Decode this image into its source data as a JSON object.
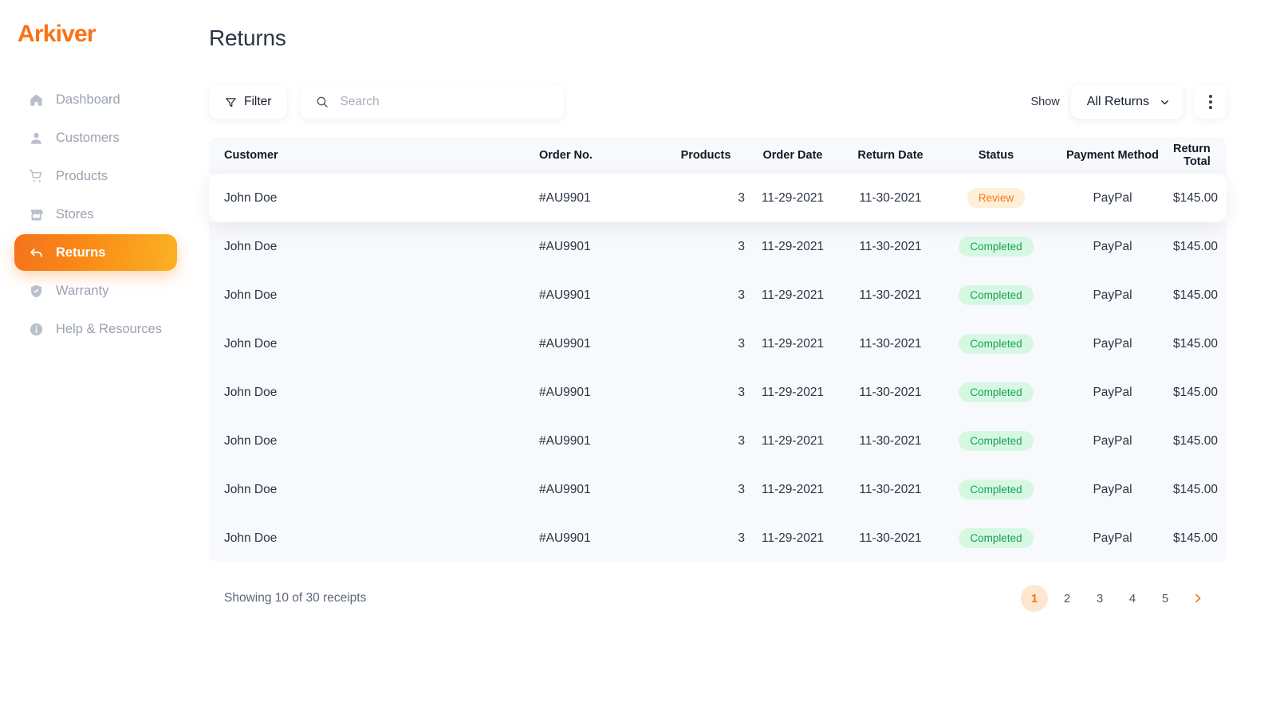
{
  "brand": {
    "name": "Arkiver",
    "color": "#F97316"
  },
  "sidebar": {
    "items": [
      {
        "label": "Dashboard",
        "icon": "home-icon",
        "active": false
      },
      {
        "label": "Customers",
        "icon": "user-icon",
        "active": false
      },
      {
        "label": "Products",
        "icon": "cart-icon",
        "active": false
      },
      {
        "label": "Stores",
        "icon": "store-icon",
        "active": false
      },
      {
        "label": "Returns",
        "icon": "return-icon",
        "active": true
      },
      {
        "label": "Warranty",
        "icon": "shield-icon",
        "active": false
      },
      {
        "label": "Help & Resources",
        "icon": "info-icon",
        "active": false
      }
    ]
  },
  "header": {
    "title": "Returns"
  },
  "toolbar": {
    "filter_label": "Filter",
    "filter_icon": "funnel-icon",
    "search_placeholder": "Search",
    "search_value": "",
    "search_icon": "search-icon",
    "show_label": "Show",
    "select_value": "All Returns",
    "select_icon": "chevron-down-icon",
    "more_icon": "kebab-menu-icon"
  },
  "table": {
    "columns": [
      "Customer",
      "Order No.",
      "Products",
      "Order Date",
      "Return Date",
      "Status",
      "Payment Method",
      "Return Total"
    ],
    "rows": [
      {
        "customer": "John Doe",
        "order_no": "#AU9901",
        "products": "3",
        "order_date": "11-29-2021",
        "return_date": "11-30-2021",
        "status": "Review",
        "status_kind": "review",
        "payment": "PayPal",
        "total": "$145.00"
      },
      {
        "customer": "John Doe",
        "order_no": "#AU9901",
        "products": "3",
        "order_date": "11-29-2021",
        "return_date": "11-30-2021",
        "status": "Completed",
        "status_kind": "completed",
        "payment": "PayPal",
        "total": "$145.00"
      },
      {
        "customer": "John Doe",
        "order_no": "#AU9901",
        "products": "3",
        "order_date": "11-29-2021",
        "return_date": "11-30-2021",
        "status": "Completed",
        "status_kind": "completed",
        "payment": "PayPal",
        "total": "$145.00"
      },
      {
        "customer": "John Doe",
        "order_no": "#AU9901",
        "products": "3",
        "order_date": "11-29-2021",
        "return_date": "11-30-2021",
        "status": "Completed",
        "status_kind": "completed",
        "payment": "PayPal",
        "total": "$145.00"
      },
      {
        "customer": "John Doe",
        "order_no": "#AU9901",
        "products": "3",
        "order_date": "11-29-2021",
        "return_date": "11-30-2021",
        "status": "Completed",
        "status_kind": "completed",
        "payment": "PayPal",
        "total": "$145.00"
      },
      {
        "customer": "John Doe",
        "order_no": "#AU9901",
        "products": "3",
        "order_date": "11-29-2021",
        "return_date": "11-30-2021",
        "status": "Completed",
        "status_kind": "completed",
        "payment": "PayPal",
        "total": "$145.00"
      },
      {
        "customer": "John Doe",
        "order_no": "#AU9901",
        "products": "3",
        "order_date": "11-29-2021",
        "return_date": "11-30-2021",
        "status": "Completed",
        "status_kind": "completed",
        "payment": "PayPal",
        "total": "$145.00"
      },
      {
        "customer": "John Doe",
        "order_no": "#AU9901",
        "products": "3",
        "order_date": "11-29-2021",
        "return_date": "11-30-2021",
        "status": "Completed",
        "status_kind": "completed",
        "payment": "PayPal",
        "total": "$145.00"
      }
    ]
  },
  "footer": {
    "showing": "Showing 10 of 30 receipts",
    "pages": [
      "1",
      "2",
      "3",
      "4",
      "5"
    ],
    "active_page": "1",
    "next_icon": "chevron-right-icon"
  },
  "colors": {
    "accent": "#F97316",
    "badge_review_bg": "#FEEFD9",
    "badge_review_text": "#F4781B",
    "badge_completed_bg": "#D6F8E2",
    "badge_completed_text": "#15A254",
    "table_bg": "#F8F9FC"
  }
}
